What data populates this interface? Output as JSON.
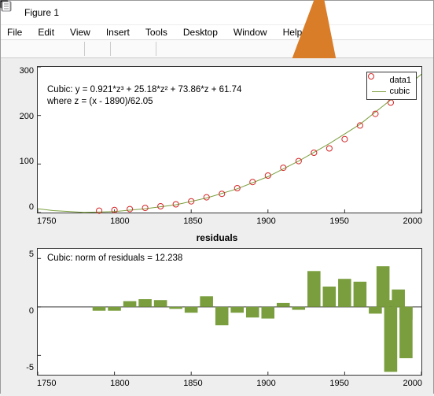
{
  "window": {
    "title": "Figure 1"
  },
  "menus": {
    "file": "File",
    "edit": "Edit",
    "view": "View",
    "insert": "Insert",
    "tools": "Tools",
    "desktop": "Desktop",
    "window": "Window",
    "help": "Help"
  },
  "subtitle": "residuals",
  "fit_annotation": {
    "line1": "Cubic:  y = 0.921*z³ + 25.18*z² + 73.86*z + 61.74",
    "line2": "where z = (x - 1890)/62.05"
  },
  "resid_annotation": "Cubic: norm of residuals = 12.238",
  "legend": {
    "data": "data1",
    "fit": "cubic"
  },
  "axis1": {
    "xticks": [
      "1750",
      "1800",
      "1850",
      "1900",
      "1950",
      "2000"
    ],
    "yticks": [
      "300",
      "200",
      "100",
      "0"
    ]
  },
  "axis2": {
    "xticks": [
      "1750",
      "1800",
      "1850",
      "1900",
      "1950",
      "2000"
    ],
    "yticks": [
      "5",
      "0",
      "-5"
    ]
  },
  "chart_data": [
    {
      "type": "scatter+line",
      "title": "Cubic fit",
      "xlabel": "",
      "ylabel": "",
      "xlim": [
        1750,
        2000
      ],
      "ylim": [
        0,
        300
      ],
      "series": [
        {
          "name": "data1",
          "type": "scatter",
          "color": "#d62728",
          "x": [
            1790,
            1800,
            1810,
            1820,
            1830,
            1840,
            1850,
            1860,
            1870,
            1880,
            1890,
            1900,
            1910,
            1920,
            1930,
            1940,
            1950,
            1960,
            1970,
            1980,
            1990
          ],
          "y": [
            3.9,
            5.3,
            7.2,
            9.6,
            12.9,
            17.1,
            23.2,
            31.4,
            38.6,
            50.2,
            63.0,
            76.2,
            92.2,
            106.0,
            123.2,
            132.2,
            151.3,
            179.3,
            203.3,
            226.5,
            248.7
          ]
        },
        {
          "name": "cubic",
          "type": "line",
          "color": "#7a9e3d",
          "x": [
            1750,
            1760,
            1780,
            1800,
            1820,
            1840,
            1860,
            1880,
            1900,
            1920,
            1940,
            1960,
            1980,
            2000
          ],
          "y": [
            8,
            4,
            0.5,
            2,
            8,
            16,
            30,
            49,
            74,
            106,
            142,
            182,
            232,
            285
          ]
        }
      ],
      "annotations": [
        "Cubic:  y = 0.921*z^3 + 25.18*z^2 + 73.86*z + 61.74",
        "where z = (x - 1890)/62.05"
      ],
      "legend": [
        "data1",
        "cubic"
      ]
    },
    {
      "type": "bar",
      "title": "residuals",
      "xlabel": "",
      "ylabel": "",
      "xlim": [
        1750,
        2000
      ],
      "ylim": [
        -7,
        6
      ],
      "color": "#7a9e3d",
      "categories": [
        1790,
        1800,
        1810,
        1820,
        1830,
        1840,
        1850,
        1860,
        1870,
        1880,
        1890,
        1900,
        1910,
        1920,
        1930,
        1940,
        1950,
        1960,
        1970,
        1980,
        1990
      ],
      "values": [
        -0.4,
        -0.4,
        0.6,
        0.8,
        0.7,
        -0.2,
        -0.6,
        1.1,
        -1.9,
        -0.6,
        -1.1,
        -1.2,
        0.4,
        -0.3,
        3.7,
        2.1,
        2.9,
        2.6,
        -0.7,
        -6.7,
        -5.3
      ],
      "extra_bars": {
        "categories": [
          1965,
          1975,
          1980,
          1985,
          1990,
          1995
        ],
        "values": [
          0.0,
          4.2,
          0.7,
          1.8,
          -1.3,
          0.0
        ]
      },
      "annotations": [
        "Cubic: norm of residuals = 12.238"
      ]
    }
  ]
}
